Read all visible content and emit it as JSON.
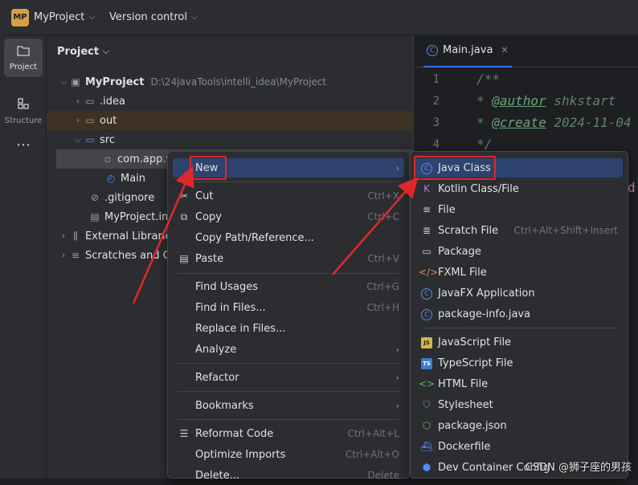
{
  "titlebar": {
    "badge": "MP",
    "project": "MyProject",
    "version_control": "Version control"
  },
  "sidestrip": {
    "project_label": "Project",
    "structure_label": "Structure",
    "more": "⋯"
  },
  "project_pane": {
    "title": "Project",
    "tree": [
      {
        "label": "MyProject",
        "path": "D:\\24javaTools\\intelli_idea\\MyProject"
      },
      {
        "label": ".idea"
      },
      {
        "label": "out"
      },
      {
        "label": "src"
      },
      {
        "label": "com.app.v"
      },
      {
        "label": "Main"
      },
      {
        "label": ".gitignore"
      },
      {
        "label": "MyProject.iml"
      },
      {
        "label": "External Libraries"
      },
      {
        "label": "Scratches and Co"
      }
    ]
  },
  "editor": {
    "tab": "Main.java",
    "lines": [
      "1",
      "2",
      "3",
      "4"
    ],
    "code": {
      "l1": "/**",
      "l2_prefix": " * ",
      "l2_tag": "@author",
      "l2_rest": " shkstart",
      "l3_prefix": " * ",
      "l3_tag": "@create",
      "l3_rest": " 2024-11-04",
      "l4": " */",
      "trailing": "d"
    }
  },
  "context_menu": {
    "items": [
      {
        "label": "New",
        "shortcut": ""
      },
      {
        "label": "Cut",
        "shortcut": "Ctrl+X"
      },
      {
        "label": "Copy",
        "shortcut": "Ctrl+C"
      },
      {
        "label": "Copy Path/Reference...",
        "shortcut": ""
      },
      {
        "label": "Paste",
        "shortcut": "Ctrl+V"
      },
      {
        "label": "Find Usages",
        "shortcut": "Ctrl+G"
      },
      {
        "label": "Find in Files...",
        "shortcut": "Ctrl+H"
      },
      {
        "label": "Replace in Files...",
        "shortcut": ""
      },
      {
        "label": "Analyze",
        "shortcut": ""
      },
      {
        "label": "Refactor",
        "shortcut": ""
      },
      {
        "label": "Bookmarks",
        "shortcut": ""
      },
      {
        "label": "Reformat Code",
        "shortcut": "Ctrl+Alt+L"
      },
      {
        "label": "Optimize Imports",
        "shortcut": "Ctrl+Alt+O"
      },
      {
        "label": "Delete...",
        "shortcut": "Delete"
      }
    ]
  },
  "new_submenu": {
    "items": [
      {
        "label": "Java Class",
        "shortcut": ""
      },
      {
        "label": "Kotlin Class/File",
        "shortcut": ""
      },
      {
        "label": "File",
        "shortcut": ""
      },
      {
        "label": "Scratch File",
        "shortcut": "Ctrl+Alt+Shift+Insert"
      },
      {
        "label": "Package",
        "shortcut": ""
      },
      {
        "label": "FXML File",
        "shortcut": ""
      },
      {
        "label": "JavaFX Application",
        "shortcut": ""
      },
      {
        "label": "package-info.java",
        "shortcut": ""
      },
      {
        "label": "JavaScript File",
        "shortcut": ""
      },
      {
        "label": "TypeScript File",
        "shortcut": ""
      },
      {
        "label": "HTML File",
        "shortcut": ""
      },
      {
        "label": "Stylesheet",
        "shortcut": ""
      },
      {
        "label": "package.json",
        "shortcut": ""
      },
      {
        "label": "Dockerfile",
        "shortcut": ""
      },
      {
        "label": "Dev Container Config",
        "shortcut": ""
      }
    ]
  },
  "icons": {
    "js": "JS",
    "ts": "TS"
  },
  "watermark": "CSDN @狮子座的男孩",
  "colors": {
    "accent": "#3574f0",
    "selection": "#2e436e",
    "annotation_red": "#e0272c",
    "comment_green": "#5f826b"
  }
}
